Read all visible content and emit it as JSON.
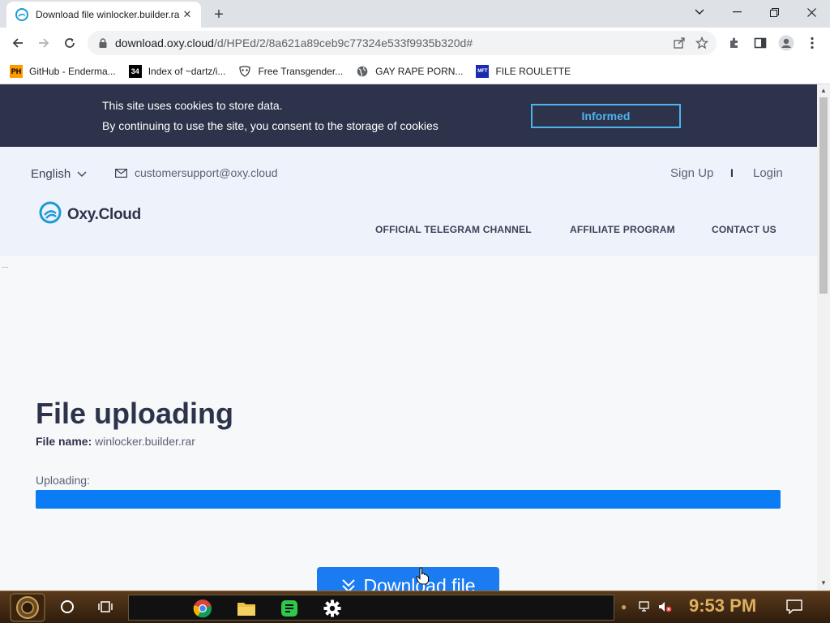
{
  "browser": {
    "tab_title": "Download file winlocker.builder.rar",
    "new_tab": "+",
    "url_host": "download.oxy.cloud",
    "url_path": "/d/HPEd/2/8a621a89ceb9c77324e533f9935b320d#",
    "bookmarks": [
      {
        "icon": "PH",
        "label": "GitHub - Enderma..."
      },
      {
        "icon": "34",
        "label": "Index of ~dartz/i..."
      },
      {
        "icon": "mask",
        "label": "Free Transgender..."
      },
      {
        "icon": "globe",
        "label": "GAY RAPE PORN..."
      },
      {
        "icon": "MFT",
        "label": "FILE ROULETTE"
      }
    ]
  },
  "cookie": {
    "line1": "This site uses cookies to store data.",
    "line2": "By continuing to use the site, you consent to the storage of cookies",
    "button": "Informed"
  },
  "header": {
    "language": "English",
    "email": "customersupport@oxy.cloud",
    "signup": "Sign Up",
    "separator": "I",
    "login": "Login",
    "logo": "Oxy.Cloud",
    "nav": [
      "OFFICIAL TELEGRAM CHANNEL",
      "AFFILIATE PROGRAM",
      "CONTACT US"
    ]
  },
  "main": {
    "dots": "...",
    "title": "File uploading",
    "file_label": "File name:",
    "file_name": "winlocker.builder.rar",
    "uploading_label": "Uploading:",
    "progress": 1.0,
    "download_label": "Download file"
  },
  "taskbar": {
    "clock": "9:53 PM"
  },
  "colors": {
    "cookie_bg": "#2d334a",
    "accent": "#1b7cf2",
    "progress": "#0a7cf6",
    "cookie_btn": "#4fb3f0"
  }
}
